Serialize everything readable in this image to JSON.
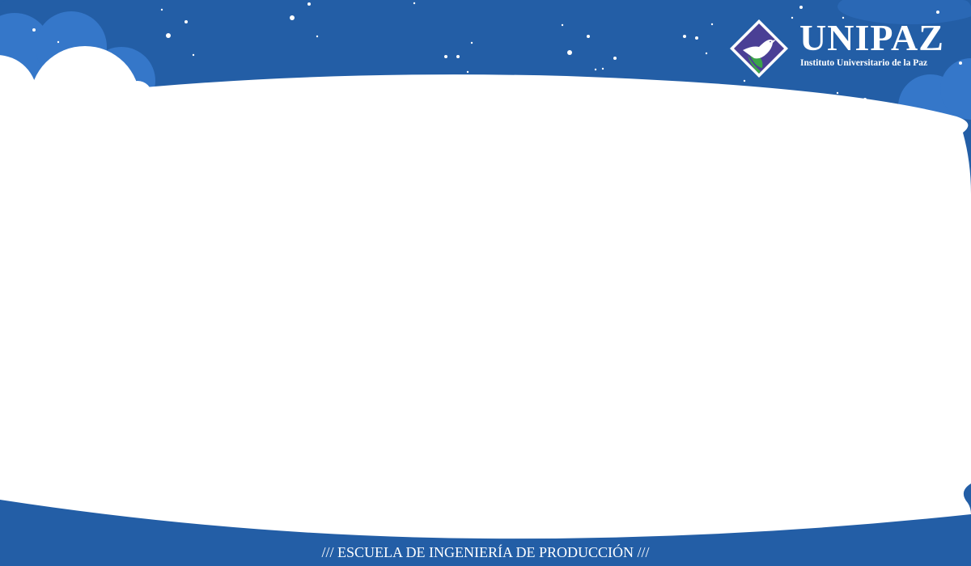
{
  "brand": {
    "name": "UNIPAZ",
    "subtitle": "Instituto Universitario de la Paz",
    "logo_icon": "dove-diamond-icon"
  },
  "footer": {
    "text": "/// ESCUELA DE INGENIERÍA DE PRODUCCIÓN ///"
  },
  "colors": {
    "background_blue": "#235ea6",
    "cloud_blue": "#3577c9",
    "panel_white": "#ffffff",
    "logo_purple": "#4a3f95",
    "logo_green": "#3aa548"
  }
}
